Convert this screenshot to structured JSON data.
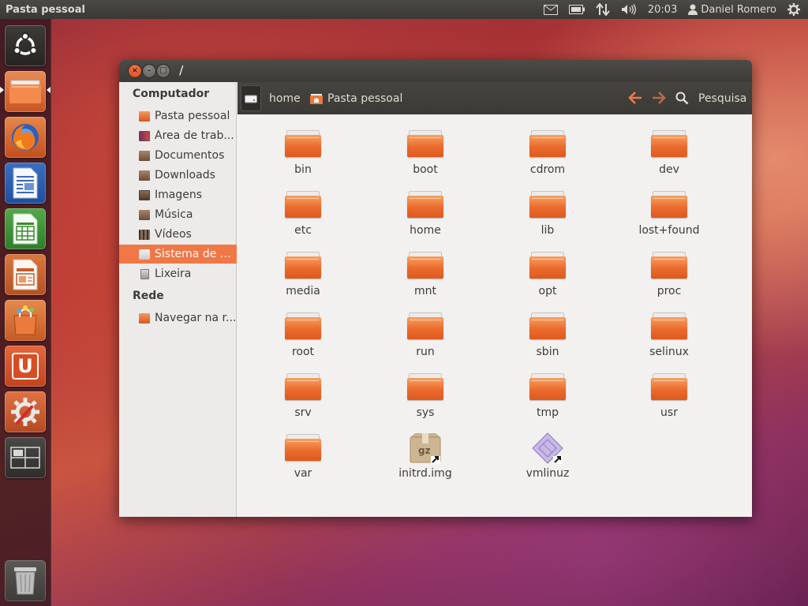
{
  "top_panel": {
    "app_title": "Pasta pessoal",
    "clock": "20:03",
    "user_name": "Daniel Romero",
    "icons": [
      "mail-icon",
      "battery-icon",
      "network-icon",
      "volume-icon",
      "user-icon",
      "gear-icon"
    ]
  },
  "launcher": {
    "items": [
      {
        "name": "ubuntu-dash",
        "icon": "ubuntu-logo-icon"
      },
      {
        "name": "files",
        "icon": "folder-icon",
        "running": true
      },
      {
        "name": "firefox",
        "icon": "firefox-icon"
      },
      {
        "name": "libreoffice-writer",
        "icon": "writer-icon"
      },
      {
        "name": "libreoffice-calc",
        "icon": "calc-icon"
      },
      {
        "name": "libreoffice-impress",
        "icon": "impress-icon"
      },
      {
        "name": "software-center",
        "icon": "shopping-bag-icon"
      },
      {
        "name": "ubuntu-one",
        "icon": "ubuntu-one-icon",
        "glyph": "U"
      },
      {
        "name": "system-settings",
        "icon": "settings-icon"
      },
      {
        "name": "workspace-switcher",
        "icon": "workspace-icon"
      },
      {
        "name": "trash",
        "icon": "trash-icon"
      }
    ]
  },
  "window": {
    "title": "/",
    "controls": {
      "close": "×",
      "minimize": "–",
      "maximize": "□"
    }
  },
  "sidebar": {
    "computer_heading": "Computador",
    "network_heading": "Rede",
    "items": [
      {
        "label": "Pasta pessoal",
        "icon": "home-folder-icon"
      },
      {
        "label": "Área de trab...",
        "icon": "desktop-icon"
      },
      {
        "label": "Documentos",
        "icon": "documents-icon"
      },
      {
        "label": "Downloads",
        "icon": "downloads-icon"
      },
      {
        "label": "Imagens",
        "icon": "pictures-icon"
      },
      {
        "label": "Música",
        "icon": "music-icon"
      },
      {
        "label": "Vídeos",
        "icon": "videos-icon"
      },
      {
        "label": "Sistema de a...",
        "icon": "drive-icon",
        "active": true
      },
      {
        "label": "Lixeira",
        "icon": "trash-icon"
      }
    ],
    "network_items": [
      {
        "label": "Navegar na r...",
        "icon": "network-folder-icon"
      }
    ]
  },
  "toolbar": {
    "crumbs": [
      "home",
      "Pasta pessoal"
    ],
    "search_label": "Pesquisa",
    "back_icon": "arrow-left-icon",
    "forward_icon": "arrow-right-icon",
    "search_icon": "search-icon"
  },
  "files": [
    {
      "name": "bin",
      "type": "folder"
    },
    {
      "name": "boot",
      "type": "folder"
    },
    {
      "name": "cdrom",
      "type": "folder"
    },
    {
      "name": "dev",
      "type": "folder"
    },
    {
      "name": "etc",
      "type": "folder"
    },
    {
      "name": "home",
      "type": "folder"
    },
    {
      "name": "lib",
      "type": "folder"
    },
    {
      "name": "lost+found",
      "type": "folder"
    },
    {
      "name": "media",
      "type": "folder"
    },
    {
      "name": "mnt",
      "type": "folder"
    },
    {
      "name": "opt",
      "type": "folder"
    },
    {
      "name": "proc",
      "type": "folder"
    },
    {
      "name": "root",
      "type": "folder"
    },
    {
      "name": "run",
      "type": "folder"
    },
    {
      "name": "sbin",
      "type": "folder"
    },
    {
      "name": "selinux",
      "type": "folder"
    },
    {
      "name": "srv",
      "type": "folder"
    },
    {
      "name": "sys",
      "type": "folder"
    },
    {
      "name": "tmp",
      "type": "folder"
    },
    {
      "name": "usr",
      "type": "folder"
    },
    {
      "name": "var",
      "type": "folder"
    },
    {
      "name": "initrd.img",
      "type": "archive-link",
      "badge": "gz"
    },
    {
      "name": "vmlinuz",
      "type": "binary-link"
    }
  ],
  "colors": {
    "accent": "#f07746",
    "folder": "#ea6a2c",
    "panel": "#3c3b37"
  }
}
